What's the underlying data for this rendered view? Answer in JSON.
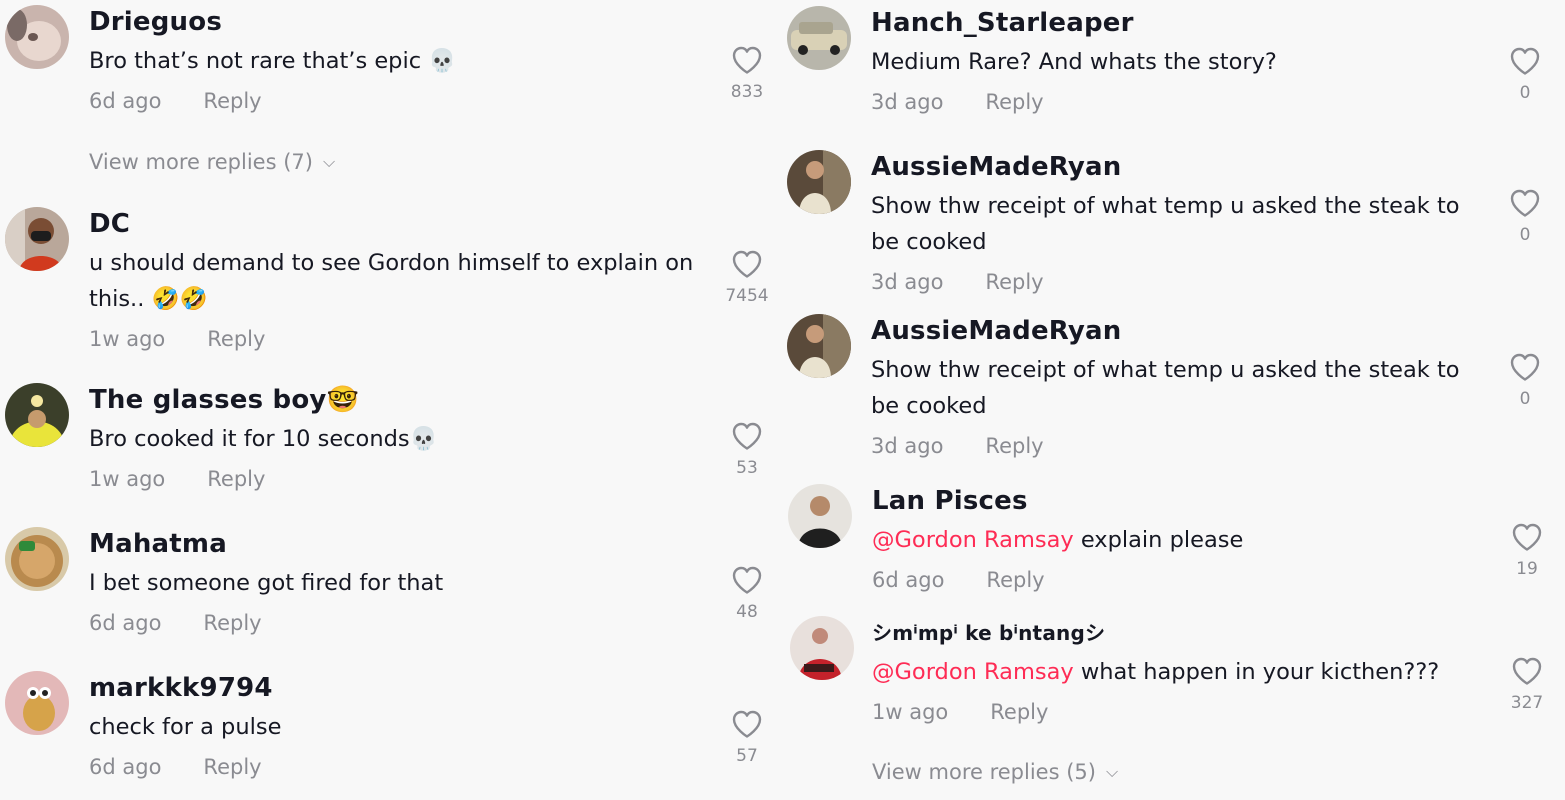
{
  "left_column": {
    "comments": [
      {
        "username": "Drieguos",
        "text": "Bro that’s not rare that’s epic 💀",
        "time": "6d ago",
        "reply": "Reply",
        "likes": "833"
      },
      {
        "username": "DC",
        "text": "u should demand to see Gordon himself to explain on this.. 🤣🤣",
        "time": "1w ago",
        "reply": "Reply",
        "likes": "7454"
      },
      {
        "username": "The glasses boy🤓",
        "text": "Bro cooked it for 10 seconds💀",
        "time": "1w ago",
        "reply": "Reply",
        "likes": "53"
      },
      {
        "username": "Mahatma",
        "text": "I bet someone got fired for that",
        "time": "6d ago",
        "reply": "Reply",
        "likes": "48"
      },
      {
        "username": "markkk9794",
        "text": "check for a pulse",
        "time": "6d ago",
        "reply": "Reply",
        "likes": "57"
      }
    ],
    "view_more": "View more replies (7)"
  },
  "right_column": {
    "comments": [
      {
        "username": "Hanch_Starleaper",
        "text": "Medium Rare? And whats the story?",
        "time": "3d ago",
        "reply": "Reply",
        "likes": "0"
      },
      {
        "username": "AussieMadeRyan",
        "text": "Show thw receipt of what temp u asked the steak to be cooked",
        "time": "3d ago",
        "reply": "Reply",
        "likes": "0"
      },
      {
        "username": "AussieMadeRyan",
        "text": "Show thw receipt of what temp u asked the steak to be cooked",
        "time": "3d ago",
        "reply": "Reply",
        "likes": "0"
      },
      {
        "username": "Lan Pisces",
        "mention": "@Gordon Ramsay",
        "text": " explain please",
        "time": "6d ago",
        "reply": "Reply",
        "likes": "19"
      },
      {
        "username": "シmⁱmpⁱ ke bⁱntangシ",
        "mention": "@Gordon Ramsay",
        "text": " what happen in your kicthen???",
        "time": "1w ago",
        "reply": "Reply",
        "likes": "327"
      }
    ],
    "view_more": "View more replies (5)"
  },
  "icons": {
    "like": "heart-outline-icon",
    "expand": "chevron-down-icon"
  },
  "colors": {
    "mention": "#fe2c55",
    "muted": "#8a8b91",
    "text": "#161823",
    "background": "#f8f8f8"
  }
}
